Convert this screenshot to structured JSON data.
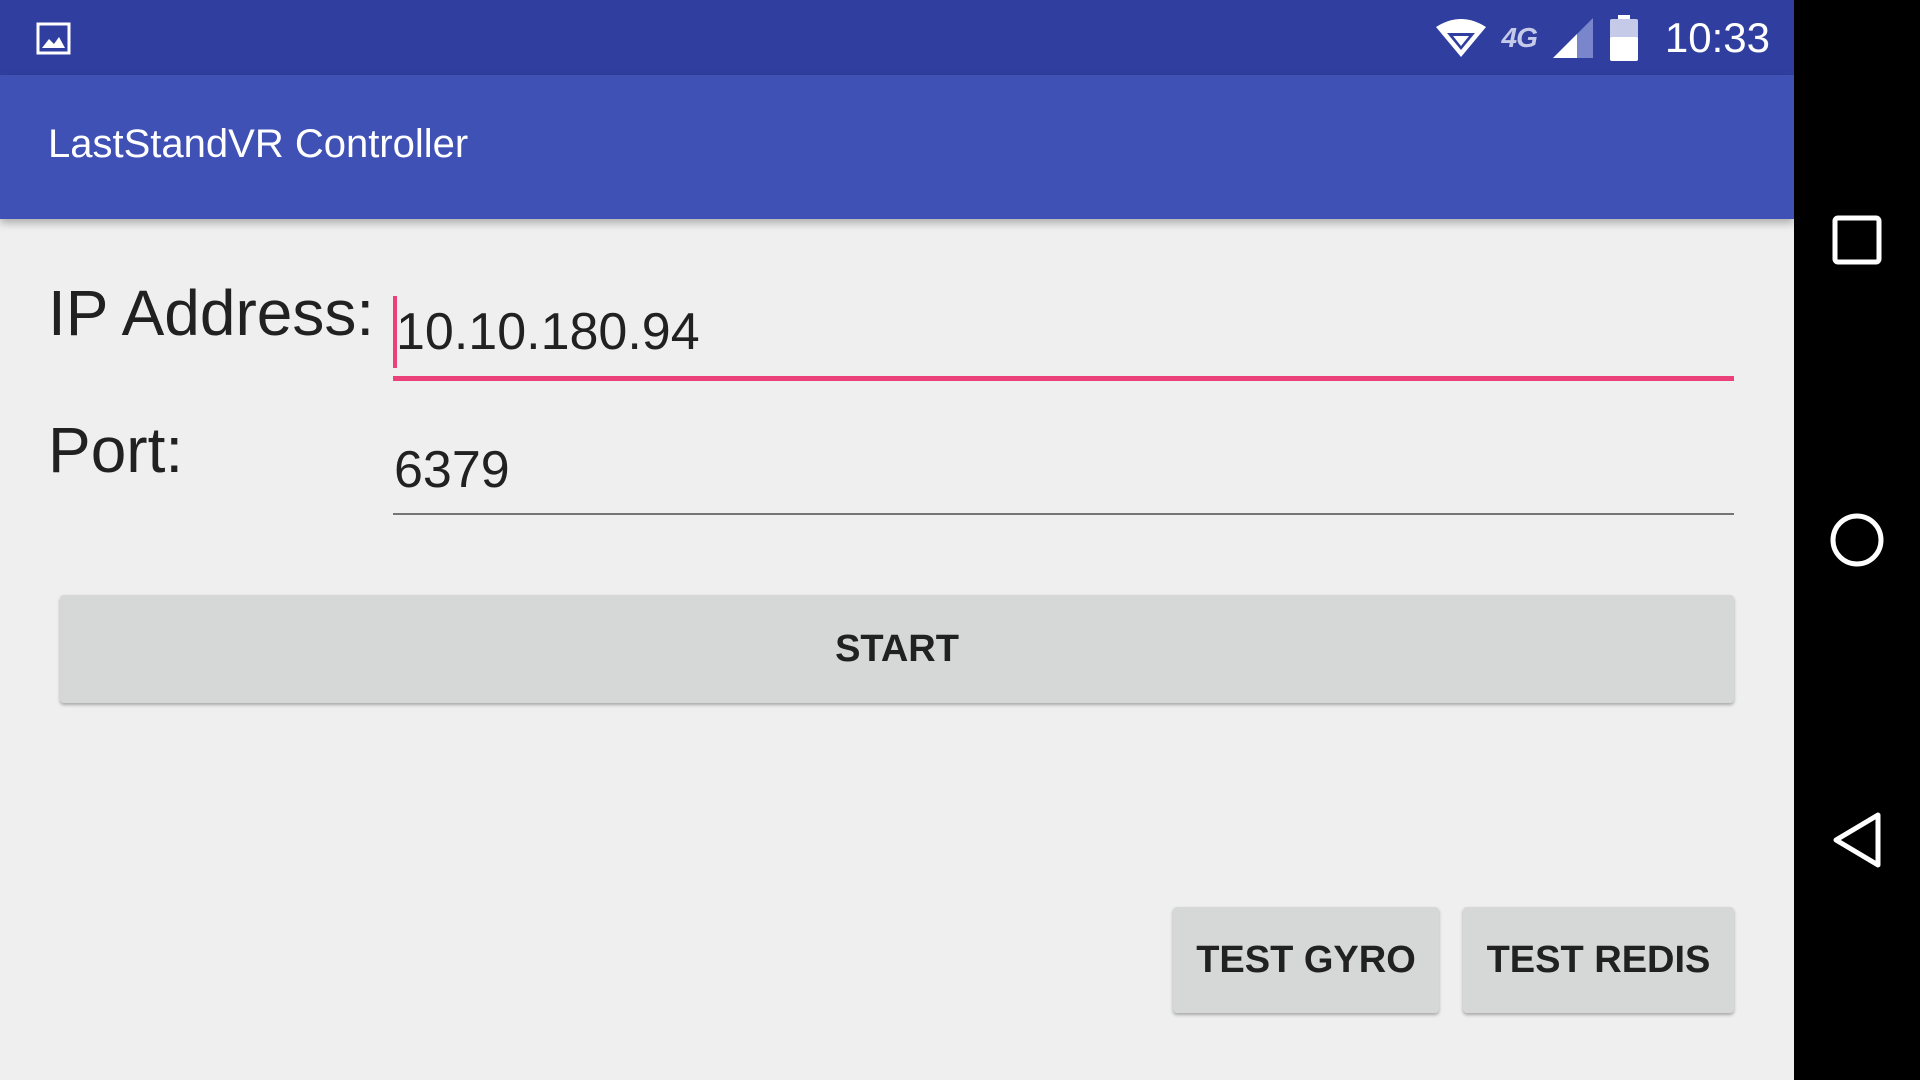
{
  "status_bar": {
    "network_label": "4G",
    "time": "10:33"
  },
  "app_bar": {
    "title": "LastStandVR Controller"
  },
  "form": {
    "ip_label": "IP Address:",
    "ip_value": "10.10.180.94",
    "port_label": "Port:",
    "port_value": "6379"
  },
  "buttons": {
    "start_label": "START",
    "test_gyro_label": "TEST GYRO",
    "test_redis_label": "TEST REDIS"
  },
  "nav_bar": {
    "icons": [
      "recents-square-icon",
      "home-circle-icon",
      "back-triangle-icon"
    ]
  },
  "colors": {
    "status_bar": "#303f9f",
    "app_bar": "#3f51b5",
    "accent": "#ec407a",
    "background": "#efefef",
    "button": "#d6d7d7"
  }
}
